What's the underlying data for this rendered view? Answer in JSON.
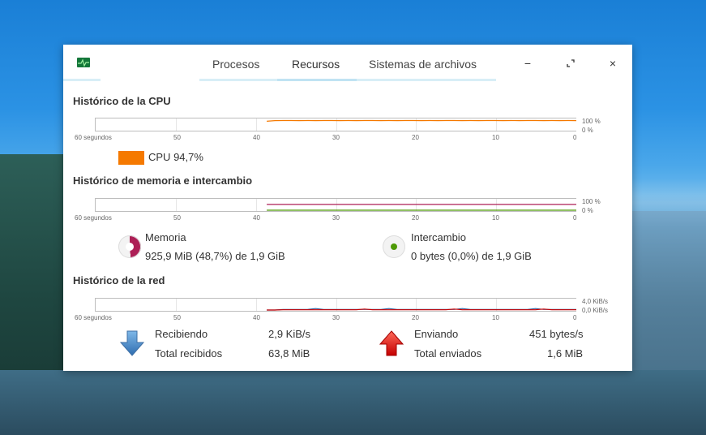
{
  "tabs": {
    "processes": "Procesos",
    "resources": "Recursos",
    "filesystems": "Sistemas de archivos"
  },
  "window_buttons": {
    "minimize": "−",
    "maximize": "⤢",
    "close": "×"
  },
  "cpu": {
    "title": "Histórico de la CPU",
    "scale_max": "100 %",
    "scale_min": "0 %",
    "legend_label": "CPU",
    "legend_value": "94,7%",
    "color": "#f57900",
    "history_percent": [
      0,
      0,
      0,
      0,
      0,
      0,
      0,
      0,
      0,
      0,
      0,
      0,
      0,
      0,
      0,
      0,
      0,
      0,
      0,
      0,
      0,
      88,
      95,
      96,
      96,
      95,
      96,
      95,
      96,
      96,
      95,
      96,
      95,
      96,
      96,
      95,
      96,
      95,
      96,
      96,
      95,
      96,
      95,
      96,
      96,
      95,
      96,
      95,
      96,
      96,
      95,
      96,
      95,
      96,
      96,
      95,
      96,
      95,
      96,
      95
    ]
  },
  "memory": {
    "title": "Histórico de memoria e intercambio",
    "scale_max": "100 %",
    "scale_min": "0 %",
    "memory_label": "Memoria",
    "memory_value": "925,9 MiB (48,7%) de 1,9 GiB",
    "memory_color": "#ad1f56",
    "memory_percent": 48.7,
    "swap_label": "Intercambio",
    "swap_value": "0 bytes (0,0%) de 1,9 GiB",
    "swap_color": "#4e9a06",
    "swap_percent": 0.0
  },
  "network": {
    "title": "Histórico de la red",
    "scale_max": "4,0 KiB/s",
    "scale_min": "0,0 KiB/s",
    "receiving_label": "Recibiendo",
    "receiving_value": "2,9 KiB/s",
    "total_received_label": "Total recibidos",
    "total_received_value": "63,8 MiB",
    "sending_label": "Enviando",
    "sending_value": "451 bytes/s",
    "total_sent_label": "Total enviados",
    "total_sent_value": "1,6 MiB",
    "receive_color": "#3465a4",
    "send_color": "#cc0000"
  },
  "time_axis": [
    "60 segundos",
    "50",
    "40",
    "30",
    "20",
    "10",
    "0"
  ]
}
